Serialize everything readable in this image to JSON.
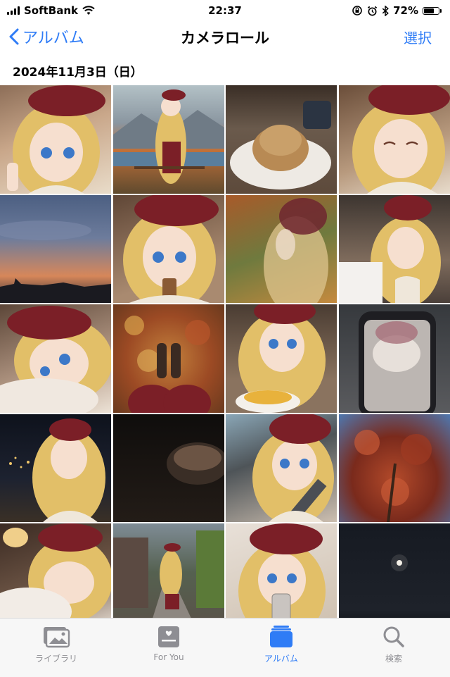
{
  "status_bar": {
    "carrier": "SoftBank",
    "time": "22:37",
    "battery_percent": "72%",
    "battery_level": 0.72
  },
  "nav": {
    "back_label": "アルバム",
    "title": "カメラロール",
    "select_label": "選択"
  },
  "section": {
    "date": "2024年11月3日（日）"
  },
  "photos": [
    {
      "desc": "girl-selfie-peace"
    },
    {
      "desc": "girl-autumn-lake"
    },
    {
      "desc": "mont-blanc-cake"
    },
    {
      "desc": "girl-smiling-eyes-closed"
    },
    {
      "desc": "sunset-sky"
    },
    {
      "desc": "girl-drinking-straw"
    },
    {
      "desc": "girl-blurry-autumn"
    },
    {
      "desc": "girl-shopping-bag"
    },
    {
      "desc": "girl-lying-pillow"
    },
    {
      "desc": "autumn-leaves-feet"
    },
    {
      "desc": "girl-omurice"
    },
    {
      "desc": "phone-screen-blur"
    },
    {
      "desc": "girl-night-city"
    },
    {
      "desc": "dark-coffee-cup"
    },
    {
      "desc": "girl-in-car"
    },
    {
      "desc": "red-autumn-tree"
    },
    {
      "desc": "girl-sleeping-lamp"
    },
    {
      "desc": "girl-walking-street"
    },
    {
      "desc": "girl-mirror-selfie"
    },
    {
      "desc": "night-moon"
    }
  ],
  "tabs": [
    {
      "label": "ライブラリ",
      "icon": "photos-library-icon"
    },
    {
      "label": "For You",
      "icon": "for-you-icon"
    },
    {
      "label": "アルバム",
      "icon": "albums-icon"
    },
    {
      "label": "検索",
      "icon": "search-icon"
    }
  ],
  "colors": {
    "accent": "#2f7cf6",
    "tab_inactive": "#8e8e93"
  }
}
